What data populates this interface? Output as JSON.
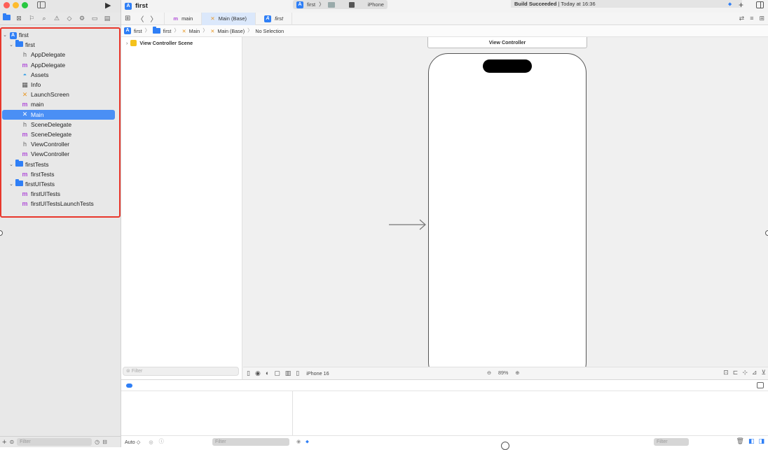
{
  "titlebar": {
    "project_name": "first",
    "scheme_target": "first",
    "scheme_device": "iPhone",
    "status_bold": "Build Succeeded",
    "status_rest": " | Today at 16:36"
  },
  "navigator": {
    "items": [
      {
        "label": "first",
        "icon": "app-icon",
        "level": 0,
        "expanded": true
      },
      {
        "label": "first",
        "icon": "folder-icon",
        "level": 1,
        "expanded": true
      },
      {
        "label": "AppDelegate",
        "icon": "header-file-icon",
        "level": 2
      },
      {
        "label": "AppDelegate",
        "icon": "objc-file-icon",
        "level": 2
      },
      {
        "label": "Assets",
        "icon": "assets-icon",
        "level": 2
      },
      {
        "label": "Info",
        "icon": "plist-icon",
        "level": 2
      },
      {
        "label": "LaunchScreen",
        "icon": "storyboard-icon",
        "level": 2
      },
      {
        "label": "main",
        "icon": "objc-file-icon",
        "level": 2
      },
      {
        "label": "Main",
        "icon": "storyboard-icon",
        "level": 2,
        "selected": true
      },
      {
        "label": "SceneDelegate",
        "icon": "header-file-icon",
        "level": 2
      },
      {
        "label": "SceneDelegate",
        "icon": "objc-file-icon",
        "level": 2
      },
      {
        "label": "ViewController",
        "icon": "header-file-icon",
        "level": 2
      },
      {
        "label": "ViewController",
        "icon": "objc-file-icon",
        "level": 2
      },
      {
        "label": "firstTests",
        "icon": "folder-icon",
        "level": 1,
        "expanded": true
      },
      {
        "label": "firstTests",
        "icon": "objc-file-icon",
        "level": 2
      },
      {
        "label": "firstUITests",
        "icon": "folder-icon",
        "level": 1,
        "expanded": true
      },
      {
        "label": "firstUITests",
        "icon": "objc-file-icon",
        "level": 2
      },
      {
        "label": "firstUITestsLaunchTests",
        "icon": "objc-file-icon",
        "level": 2
      }
    ],
    "filter_placeholder": "Filter",
    "highlight_color": "#e8372c",
    "selection_color": "#4a8ff5"
  },
  "editor": {
    "tabs": [
      {
        "label": "main",
        "icon": "objc-file-icon"
      },
      {
        "label": "Main (Base)",
        "icon": "storyboard-icon",
        "active": true
      },
      {
        "label": "first",
        "icon": "app-icon"
      }
    ],
    "jumpbar": [
      "first",
      "first",
      "Main",
      "Main (Base)",
      "No Selection"
    ],
    "outline": {
      "scene_label": "View Controller Scene",
      "filter_placeholder": "Filter"
    },
    "canvas": {
      "vc_title": "View Controller",
      "device": "iPhone 16",
      "zoom": "89%"
    }
  },
  "debug": {
    "variables_mode": "Auto ◇",
    "filter_placeholder_left": "Filter",
    "filter_placeholder_right": "Filter"
  }
}
